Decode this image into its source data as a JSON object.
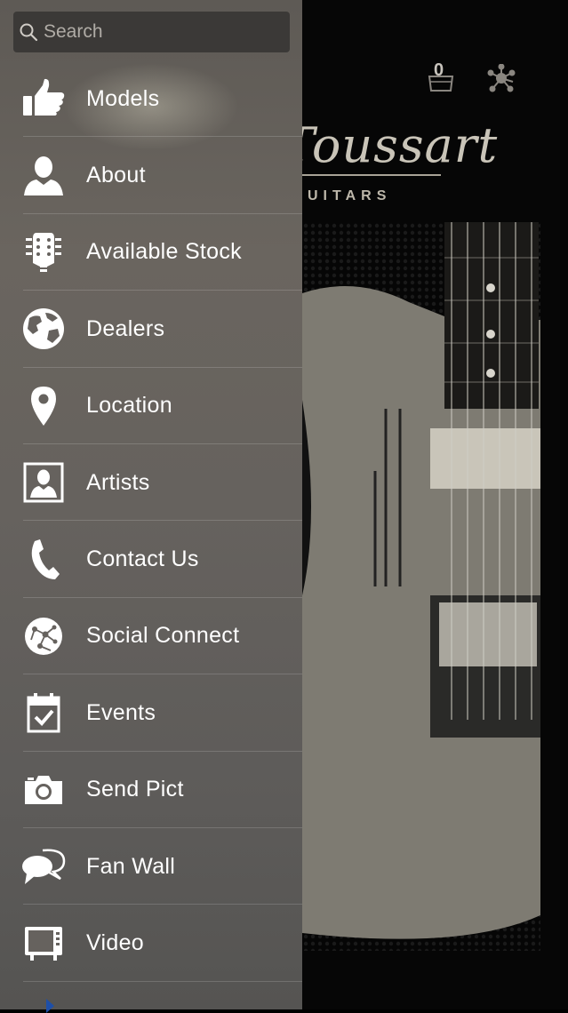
{
  "search": {
    "placeholder": "Search"
  },
  "menu": {
    "items": [
      {
        "label": "Models",
        "icon": "thumbs-up-icon"
      },
      {
        "label": "About",
        "icon": "person-icon"
      },
      {
        "label": "Available Stock",
        "icon": "guitar-headstock-icon"
      },
      {
        "label": "Dealers",
        "icon": "globe-icon"
      },
      {
        "label": "Location",
        "icon": "map-pin-icon"
      },
      {
        "label": "Artists",
        "icon": "portrait-icon"
      },
      {
        "label": "Contact Us",
        "icon": "phone-icon"
      },
      {
        "label": "Social Connect",
        "icon": "social-network-icon"
      },
      {
        "label": "Events",
        "icon": "calendar-check-icon"
      },
      {
        "label": "Send Pict",
        "icon": "camera-icon"
      },
      {
        "label": "Fan Wall",
        "icon": "chat-bubbles-icon"
      },
      {
        "label": "Video",
        "icon": "tv-icon"
      }
    ]
  },
  "background": {
    "brand_script": "Toussart",
    "brand_sub": "UITARS",
    "cart_count": "0"
  },
  "colors": {
    "drawer": "#66625e",
    "search_bg": "#3b3937",
    "text": "#ffffff",
    "more_arrow": "#1e4fa8"
  }
}
